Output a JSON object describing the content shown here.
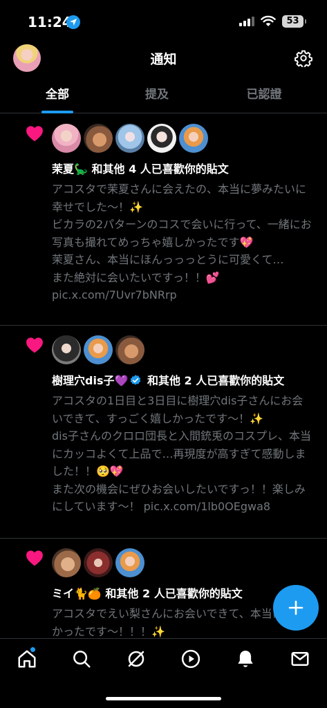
{
  "status_bar": {
    "time": "11:24",
    "battery": "53",
    "icons": [
      "location-arrow-icon",
      "cellular-signal-icon",
      "wifi-icon",
      "battery-icon"
    ]
  },
  "header": {
    "title": "通知",
    "settings_icon": "gear-icon"
  },
  "tabs": [
    {
      "label": "全部",
      "active": true
    },
    {
      "label": "提及",
      "active": false
    },
    {
      "label": "已認證",
      "active": false
    }
  ],
  "colors": {
    "accent": "#1d9bf0",
    "like": "#f91880",
    "background": "#000000",
    "secondary_text": "#71767b"
  },
  "notifications": [
    {
      "icon": "heart-icon",
      "avatar_count": 5,
      "actor": "茉夏🦕",
      "verified": false,
      "action": " 和其他 4 人已喜歡你的貼文",
      "body": "アコスタで茉夏さんに会えたの、本当に夢みたいに幸せでした〜！✨\nビカラの2パターンのコスで会いに行って、一緒にお写真も撮れてめっちゃ嬉しかったです💖\n茉夏さん、本当にほんっっっとうに可愛くて…\nまた絶対に会いたいですっ！！💕 pic.x.com/7Uvr7bNRrp"
    },
    {
      "icon": "heart-icon",
      "avatar_count": 3,
      "actor": "樹理穴dis子💜",
      "verified": true,
      "action": " 和其他 2 人已喜歡你的貼文",
      "body": "アコスタの1日目と3日目に樹理穴dis子さんにお会いできて、すっごく嬉しかったです〜！✨\ndis子さんのクロロ団長と入間銃兎のコスプレ、本当にカッコよくて上品で…再現度が高すぎて感動しました！！🥺💖\nまた次の機会にぜひお会いしたいですっ！！楽しみにしています〜！ pic.x.com/1lb0OEgwa8"
    },
    {
      "icon": "heart-icon",
      "avatar_count": 3,
      "actor": "ミイ🐈🍊",
      "verified": false,
      "action": " 和其他 2 人已喜歡你的貼文",
      "body": "アコスタでえい梨さんにお会いできて、本当に嬉しかったです〜！！！✨"
    }
  ],
  "fab": {
    "icon": "plus-icon"
  },
  "bottom_nav": [
    {
      "name": "home",
      "icon": "home-icon",
      "active": true
    },
    {
      "name": "search",
      "icon": "search-icon"
    },
    {
      "name": "grok",
      "icon": "grok-icon"
    },
    {
      "name": "video",
      "icon": "play-circle-icon"
    },
    {
      "name": "notifications",
      "icon": "bell-icon"
    },
    {
      "name": "messages",
      "icon": "mail-icon"
    }
  ]
}
